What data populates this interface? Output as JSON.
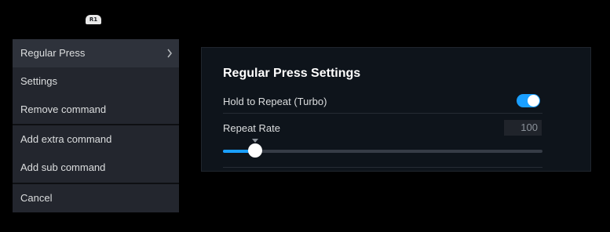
{
  "controller_badge": {
    "label": "R1"
  },
  "menu": {
    "items": [
      {
        "label": "Regular Press",
        "has_submenu": true,
        "highlighted": true
      },
      {
        "label": "Settings"
      },
      {
        "label": "Remove command"
      },
      {
        "label": "Add extra command"
      },
      {
        "label": "Add sub command"
      },
      {
        "label": "Cancel"
      }
    ],
    "submenu_icon": "chevron-right-icon"
  },
  "panel": {
    "title": "Regular Press Settings",
    "hold_to_repeat": {
      "label": "Hold to Repeat (Turbo)",
      "enabled": true
    },
    "repeat_rate": {
      "label": "Repeat Rate",
      "value": "100",
      "slider_fraction": 0.1
    }
  },
  "colors": {
    "accent": "#1a9fff",
    "menu_background": "#23262e",
    "panel_background": "#0e141b",
    "text": "#dcdedf"
  }
}
